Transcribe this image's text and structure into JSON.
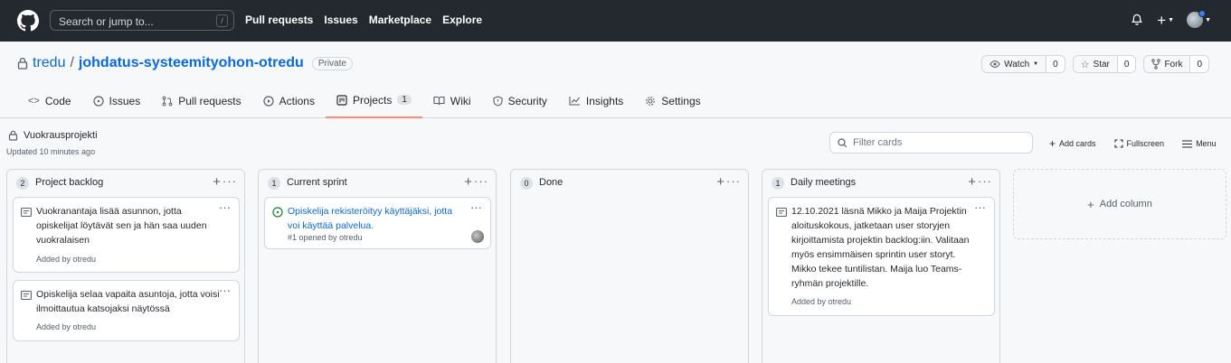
{
  "header": {
    "search_placeholder": "Search or jump to...",
    "search_shortcut": "/",
    "nav": [
      "Pull requests",
      "Issues",
      "Marketplace",
      "Explore"
    ],
    "new_label": "+"
  },
  "repo": {
    "owner": "tredu",
    "separator": "/",
    "name": "johdatus-systeemityohon-otredu",
    "visibility": "Private",
    "watch_label": "Watch",
    "watch_count": "0",
    "star_label": "Star",
    "star_count": "0",
    "fork_label": "Fork",
    "fork_count": "0"
  },
  "tabs": [
    {
      "label": "Code",
      "icon": "code-icon"
    },
    {
      "label": "Issues",
      "icon": "issue-icon"
    },
    {
      "label": "Pull requests",
      "icon": "pull-request-icon"
    },
    {
      "label": "Actions",
      "icon": "play-icon"
    },
    {
      "label": "Projects",
      "icon": "project-icon",
      "count": "1",
      "active": true
    },
    {
      "label": "Wiki",
      "icon": "book-icon"
    },
    {
      "label": "Security",
      "icon": "shield-icon"
    },
    {
      "label": "Insights",
      "icon": "graph-icon"
    },
    {
      "label": "Settings",
      "icon": "gear-icon"
    }
  ],
  "project": {
    "name": "Vuokrausprojekti",
    "updated": "Updated 10 minutes ago",
    "filter_placeholder": "Filter cards",
    "add_cards": "Add cards",
    "fullscreen": "Fullscreen",
    "menu": "Menu",
    "add_column": "Add column"
  },
  "columns": [
    {
      "title": "Project backlog",
      "count": "2",
      "cards": [
        {
          "type": "note",
          "text": "Vuokranantaja lisää asunnon, jotta opiskelijat löytävät sen ja hän saa uuden vuokralaisen",
          "meta": "Added by otredu"
        },
        {
          "type": "note",
          "text": "Opiskelija selaa vapaita asuntoja, jotta voisi ilmoittautua katsojaksi näytössä",
          "meta": "Added by otredu"
        }
      ]
    },
    {
      "title": "Current sprint",
      "count": "1",
      "cards": [
        {
          "type": "issue",
          "text": "Opiskelija rekisteröityy käyttäjäksi, jotta voi käyttää palvelua.",
          "meta": "#1 opened by otredu"
        }
      ]
    },
    {
      "title": "Done",
      "count": "0",
      "cards": []
    },
    {
      "title": "Daily meetings",
      "count": "1",
      "cards": [
        {
          "type": "note",
          "text": "12.10.2021 läsnä Mikko ja Maija Projektin aloituskokous, jatketaan user storyjen kirjoittamista projektin backlog:iin. Valitaan myös ensimmäisen sprintin user storyt. Mikko tekee tuntilistan. Maija luo Teams-ryhmän projektille.",
          "meta": "Added by otredu"
        }
      ]
    }
  ],
  "colors": {
    "header_bg": "#24292f",
    "link": "#0969da",
    "active_tab_underline": "#fd8c73",
    "issue_open": "#1a7f37",
    "notification_dot": "#2f81f7"
  }
}
